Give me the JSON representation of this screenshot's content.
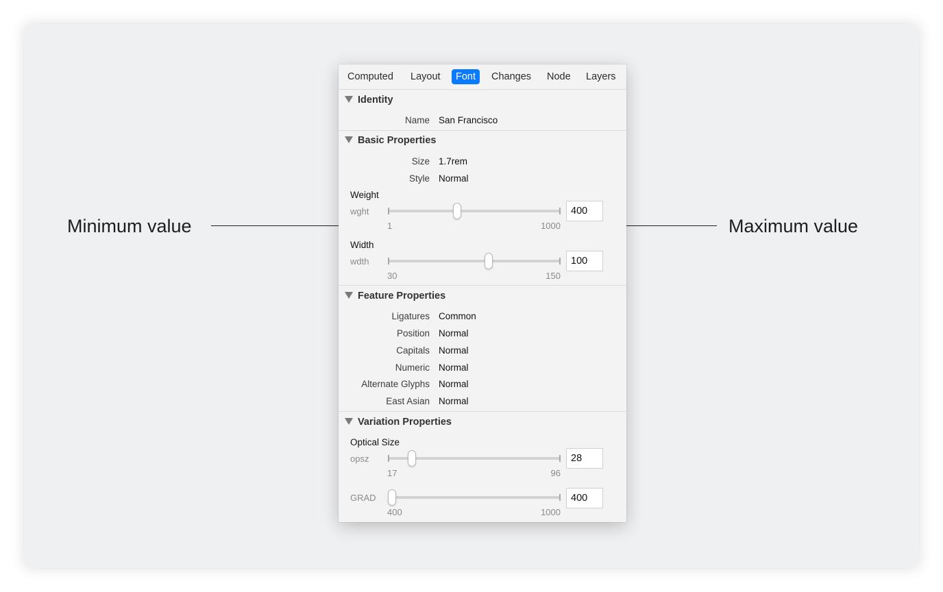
{
  "callouts": {
    "min_label": "Minimum value",
    "max_label": "Maximum value"
  },
  "tabs": [
    {
      "label": "Computed",
      "active": false
    },
    {
      "label": "Layout",
      "active": false
    },
    {
      "label": "Font",
      "active": true
    },
    {
      "label": "Changes",
      "active": false
    },
    {
      "label": "Node",
      "active": false
    },
    {
      "label": "Layers",
      "active": false
    }
  ],
  "colors": {
    "accent": "#0a7aff",
    "panel_bg": "#f3f3f3",
    "canvas_bg": "#eff0f2"
  },
  "identity": {
    "title": "Identity",
    "rows": [
      {
        "label": "Name",
        "value": "San Francisco"
      }
    ]
  },
  "basic": {
    "title": "Basic Properties",
    "rows": [
      {
        "label": "Size",
        "value": "1.7rem"
      },
      {
        "label": "Style",
        "value": "Normal"
      }
    ],
    "axes": [
      {
        "title": "Weight",
        "tag": "wght",
        "min": "1",
        "max": "1000",
        "value": "400",
        "position": 0.4
      },
      {
        "title": "Width",
        "tag": "wdth",
        "min": "30",
        "max": "150",
        "value": "100",
        "position": 0.583
      }
    ]
  },
  "feature": {
    "title": "Feature Properties",
    "rows": [
      {
        "label": "Ligatures",
        "value": "Common"
      },
      {
        "label": "Position",
        "value": "Normal"
      },
      {
        "label": "Capitals",
        "value": "Normal"
      },
      {
        "label": "Numeric",
        "value": "Normal"
      },
      {
        "label": "Alternate Glyphs",
        "value": "Normal"
      },
      {
        "label": "East Asian",
        "value": "Normal"
      }
    ]
  },
  "variation": {
    "title": "Variation Properties",
    "axes": [
      {
        "title": "Optical Size",
        "tag": "opsz",
        "min": "17",
        "max": "96",
        "value": "28",
        "position": 0.14
      },
      {
        "title": "",
        "tag": "GRAD",
        "min": "400",
        "max": "1000",
        "value": "400",
        "position": 0.0
      }
    ]
  }
}
